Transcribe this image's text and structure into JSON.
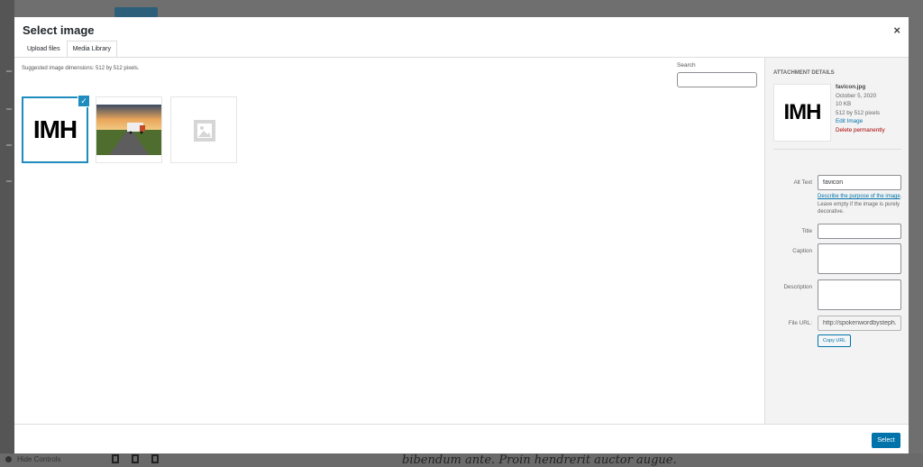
{
  "background": {
    "close_glyph": "✕",
    "hide_controls_label": "Hide Controls",
    "article_text": "bibendum ante. Proin hendrerit auctor augue."
  },
  "modal": {
    "title": "Select image",
    "close_glyph": "×",
    "tabs": [
      {
        "label": "Upload files",
        "active": false
      },
      {
        "label": "Media Library",
        "active": true
      }
    ]
  },
  "browser": {
    "suggested": "Suggested image dimensions: 512 by 512 pixels.",
    "search_label": "Search",
    "search_value": "",
    "items": [
      {
        "kind": "logo",
        "text": "IMH",
        "selected": true
      },
      {
        "kind": "photo",
        "selected": false
      },
      {
        "kind": "placeholder",
        "selected": false
      }
    ],
    "check_glyph": "✓"
  },
  "details": {
    "heading": "ATTACHMENT DETAILS",
    "preview_text": "IMH",
    "filename": "favicon.jpg",
    "date": "October 5, 2020",
    "size": "10 KB",
    "dimensions": "512 by 512 pixels",
    "edit_link": "Edit Image",
    "delete_link": "Delete permanently",
    "alt_label": "Alt Text",
    "alt_value": "favicon",
    "alt_help_link": "Describe the purpose of the image",
    "alt_help_rest": ". Leave empty if the image is purely decorative.",
    "title_label": "Title",
    "title_value": "",
    "caption_label": "Caption",
    "caption_value": "",
    "description_label": "Description",
    "description_value": "",
    "url_label": "File URL:",
    "url_value": "http://spokenwordbysteph.",
    "copy_label": "Copy URL"
  },
  "toolbar": {
    "select_label": "Select"
  },
  "colors": {
    "accent": "#0073aa",
    "selection": "#1e8cbe",
    "danger": "#aa0000"
  }
}
